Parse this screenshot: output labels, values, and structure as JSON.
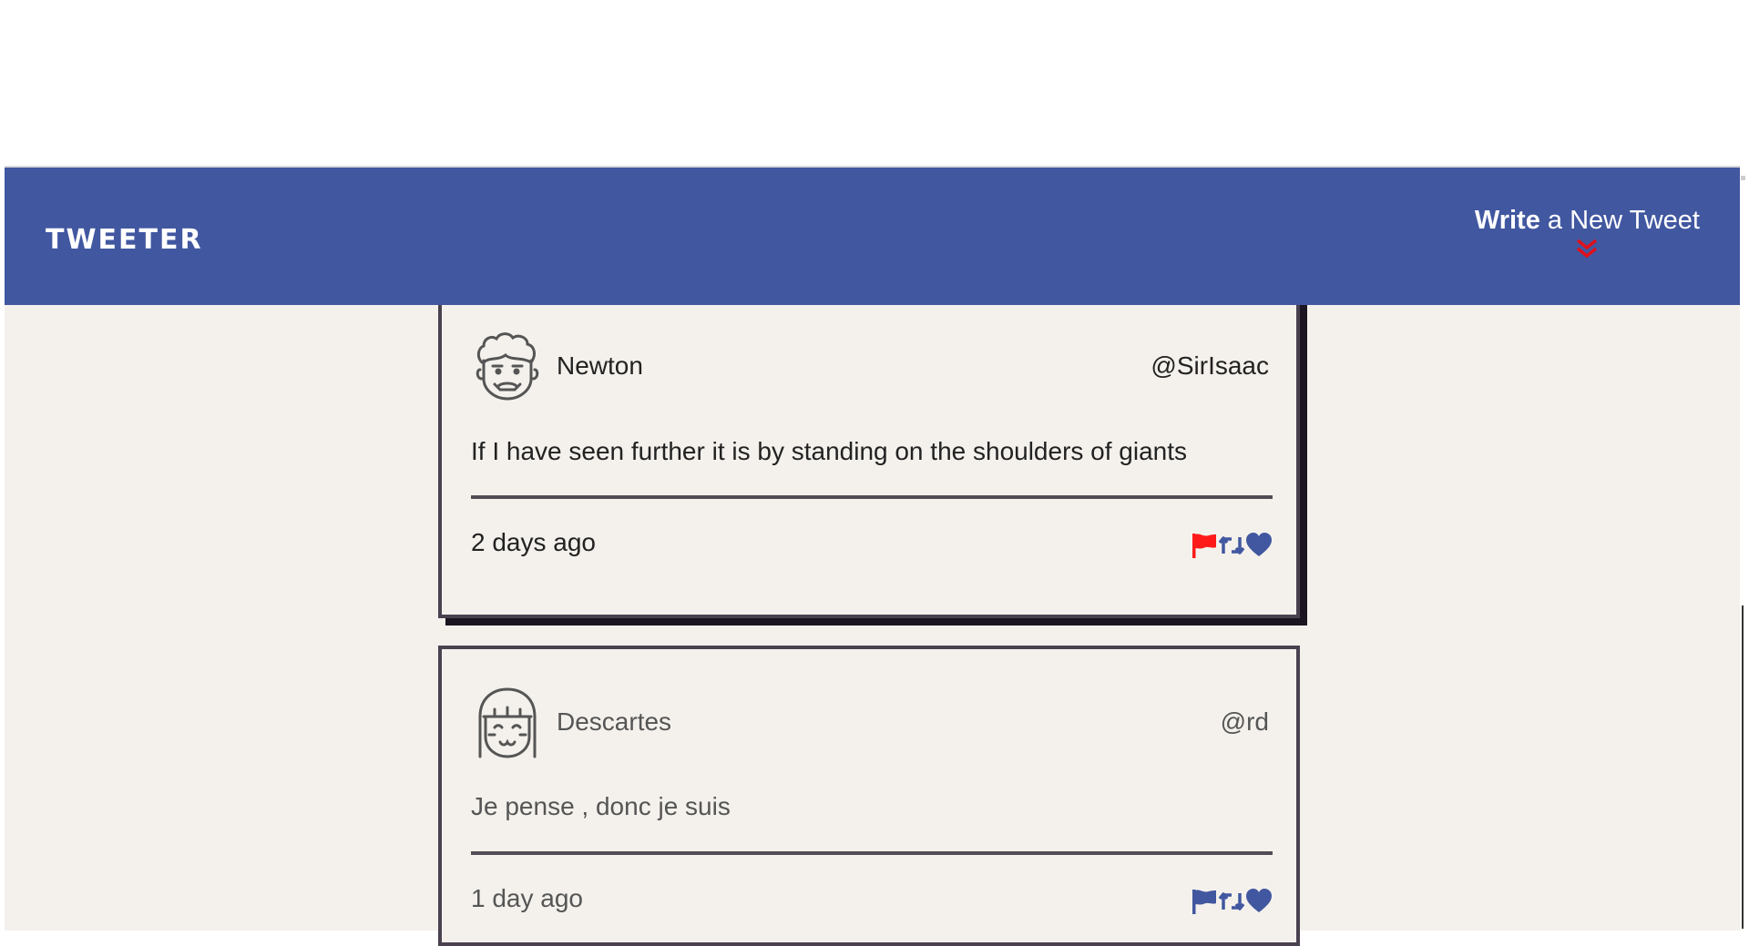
{
  "app": {
    "logo": "TWEETER",
    "compose": {
      "bold": "Write",
      "rest": " a New Tweet"
    }
  },
  "colors": {
    "nav": "#4157a0",
    "background": "#f4f1ec",
    "flag_active": "#ff1a1a",
    "icon": "#4157a0",
    "chevron": "#e0101a"
  },
  "tweets": [
    {
      "name": "Newton",
      "handle": "@SirIsaac",
      "content": "If I have seen further it is by standing on the shoulders of giants",
      "time": "2 days ago",
      "avatar_icon": "curly-hair-face-icon",
      "flag_active": true
    },
    {
      "name": "Descartes",
      "handle": "@rd",
      "content": "Je pense , donc je suis",
      "time": "1 day ago",
      "avatar_icon": "bob-hair-face-icon",
      "flag_active": false
    }
  ]
}
